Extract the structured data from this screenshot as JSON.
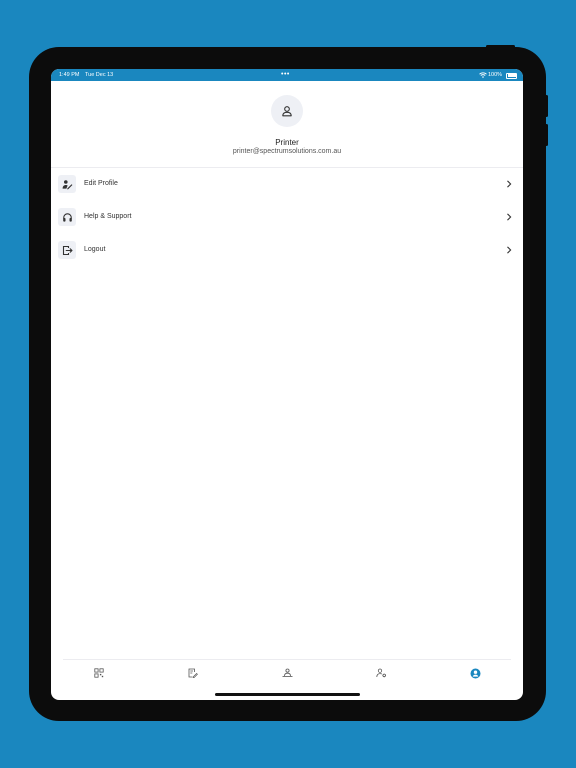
{
  "status_bar": {
    "time": "1:49 PM",
    "date": "Tue Dec 13",
    "dots": "•••",
    "battery": "100%",
    "wifi_icon": "wifi-icon",
    "battery_icon": "battery-icon"
  },
  "profile": {
    "avatar_icon": "person-icon",
    "name": "Printer",
    "email": "printer@spectrumsolutions.com.au"
  },
  "menu": [
    {
      "label": "Edit Profile",
      "icon": "edit-profile-icon"
    },
    {
      "label": "Help & Support",
      "icon": "headphones-icon"
    },
    {
      "label": "Logout",
      "icon": "logout-icon"
    }
  ],
  "tabs": [
    {
      "icon": "dashboard-grid-icon",
      "active": false
    },
    {
      "icon": "document-edit-icon",
      "active": false
    },
    {
      "icon": "users-icon",
      "active": false
    },
    {
      "icon": "user-settings-icon",
      "active": false
    },
    {
      "icon": "account-circle-icon",
      "active": true
    }
  ],
  "colors": {
    "background": "#1a87bf",
    "accent": "#1a87bf",
    "icon": "#333333",
    "tab_inactive": "#555555"
  }
}
